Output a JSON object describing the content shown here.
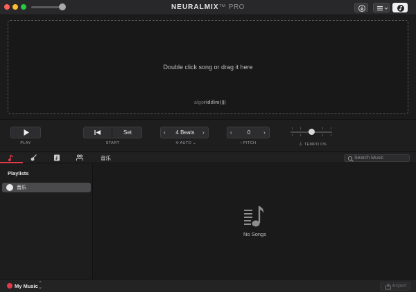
{
  "titlebar": {
    "brand_bold": "NEURAL",
    "brand_mix": "MIX",
    "brand_tm": "™",
    "brand_pro": "PRO",
    "icons": [
      "close-icon",
      "minimize-icon",
      "zoom-icon",
      "volume-slider",
      "download-icon",
      "list-view-icon",
      "music-mode-icon"
    ]
  },
  "dropzone": {
    "hint": "Double click song or drag it here",
    "logo_light": "algo",
    "logo_bold": "riddim"
  },
  "controls": {
    "play_label": "PLAY",
    "start_label": "START",
    "set_label": "Set",
    "beats_value": "4 Beats",
    "auto_label": "AUTO",
    "pitch_value": "0",
    "pitch_label": "PITCH",
    "tempo_label": "TEMPO",
    "tempo_value": "0%"
  },
  "tabs": {
    "items": [
      {
        "name": "songs-tab",
        "icon": "music-note-icon",
        "active": true
      },
      {
        "name": "instruments-tab",
        "icon": "guitar-icon",
        "active": false
      },
      {
        "name": "albums-tab",
        "icon": "album-icon",
        "active": false
      },
      {
        "name": "artists-tab",
        "icon": "artists-icon",
        "active": false
      }
    ],
    "section_title": "音乐",
    "search_placeholder": "Search Music"
  },
  "sidebar": {
    "heading": "Playlists",
    "items": [
      {
        "label": "音乐",
        "selected": true
      }
    ]
  },
  "main": {
    "empty_text": "No Songs"
  },
  "footer": {
    "library_label": "My Music",
    "export_label": "Export"
  },
  "colors": {
    "accent": "#e23a4a",
    "background": "#1b1b1c"
  }
}
